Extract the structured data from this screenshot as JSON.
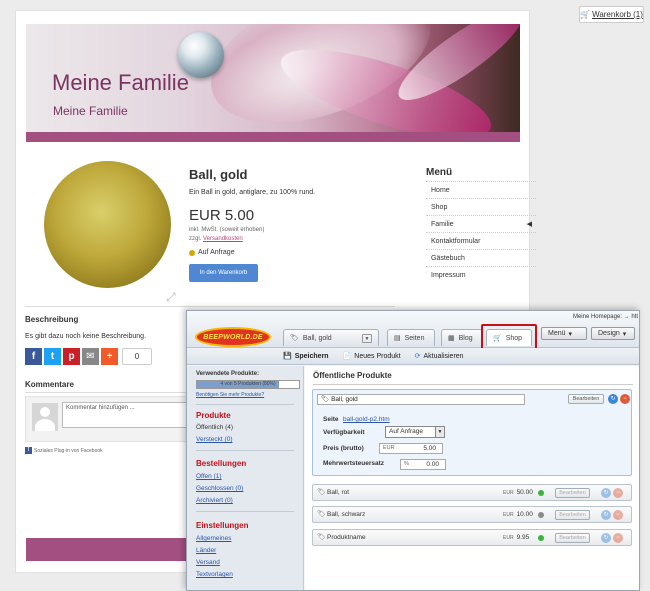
{
  "cart": {
    "label": "Warenkorb (1)"
  },
  "site": {
    "title": "Meine Familie",
    "subtitle": "Meine Familie"
  },
  "product": {
    "title": "Ball, gold",
    "description": "Ein Ball in gold, antiglare, zu 100% rund.",
    "price": "EUR 5.00",
    "tax_note": "inkl. MwSt. (soweit erhoben)",
    "shipping_prefix": "zzgl.",
    "shipping_link": "Versandkosten",
    "availability": "Auf Anfrage",
    "buy_button": "In den Warenkorb"
  },
  "menu": {
    "title": "Menü",
    "items": [
      "Home",
      "Shop",
      "Familie",
      "Kontaktformular",
      "Gästebuch",
      "Impressum"
    ]
  },
  "description_section": {
    "heading": "Beschreibung",
    "text": "Es gibt dazu noch keine Beschreibung.",
    "share_count": "0"
  },
  "comments": {
    "heading": "Kommentare",
    "placeholder": "Kommentar hinzufügen ...",
    "plugin_note": "Soziales Plug-in von Facebook"
  },
  "cms": {
    "homepage_label": "Meine Homepage: → htt",
    "logo": "BEEPWORLD.DE",
    "tabs": {
      "page": "Ball, gold",
      "seiten": "Seiten",
      "blog": "Blog",
      "shop": "Shop"
    },
    "menu_btn": "Menü",
    "design_btn": "Design",
    "toolbar": {
      "save": "Speichern",
      "new_product": "Neues Produkt",
      "refresh": "Aktualisieren"
    },
    "sidebar": {
      "used_label": "Verwendete Produkte:",
      "used_bar_text": "4 von 5 Produkten (80%)",
      "used_fraction": 0.8,
      "more_link": "Benötigen Sie mehr Produkte?",
      "produkte_head": "Produkte",
      "oeffentlich": "Öffentlich (4)",
      "versteckt": "Versteckt (0)",
      "bestellungen_head": "Bestellungen",
      "offen": "Offen (1)",
      "geschlossen": "Geschlossen (0)",
      "archiviert": "Archiviert (0)",
      "einstellungen_head": "Einstellungen",
      "allgemeines": "Allgemeines",
      "laender": "Länder",
      "versand": "Versand",
      "textvorlagen": "Textvorlagen"
    },
    "main": {
      "heading": "Öffentliche Produkte",
      "edit_label": "Bearbeiten",
      "active": {
        "name": "Ball, gold",
        "page_label": "Seite",
        "page_link": "ball-gold-p2.htm",
        "avail_label": "Verfügbarkeit",
        "avail_value": "Auf Anfrage",
        "price_label": "Preis (brutto)",
        "currency": "EUR",
        "price": "5.00",
        "vat_label": "Mehrwertsteuersatz",
        "vat_unit": "%",
        "vat": "0.00"
      },
      "rows": [
        {
          "name": "Ball, rot",
          "currency": "EUR",
          "price": "50.00",
          "status": "#3cb43c"
        },
        {
          "name": "Ball, schwarz",
          "currency": "EUR",
          "price": "10.00",
          "status": "#8a8a8a"
        },
        {
          "name": "Produktname",
          "currency": "EUR",
          "price": "9.95",
          "status": "#3cb43c"
        }
      ]
    }
  }
}
